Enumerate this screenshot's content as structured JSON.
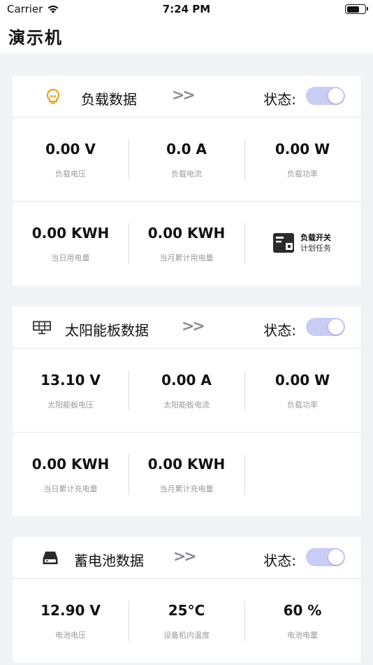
{
  "status_bar": {
    "carrier": "Carrier",
    "time": "7:24 PM"
  },
  "header": {
    "title": "演示机"
  },
  "status_label": "状态:",
  "chevron": ">>",
  "load": {
    "title": "负载数据",
    "toggle_on": true,
    "rows": [
      [
        {
          "value": "0.00 V",
          "label": "负载电压"
        },
        {
          "value": "0.0 A",
          "label": "负载电流"
        },
        {
          "value": "0.00 W",
          "label": "负载功率"
        }
      ],
      [
        {
          "value": "0.00 KWH",
          "label": "当日用电量"
        },
        {
          "value": "0.00 KWH",
          "label": "当月累计用电量"
        }
      ]
    ],
    "plan": {
      "line1": "负载开关",
      "line2": "计划任务"
    }
  },
  "solar": {
    "title": "太阳能板数据",
    "toggle_on": true,
    "rows": [
      [
        {
          "value": "13.10 V",
          "label": "太阳能板电压"
        },
        {
          "value": "0.00 A",
          "label": "太阳能板电流"
        },
        {
          "value": "0.00 W",
          "label": "负载功率"
        }
      ],
      [
        {
          "value": "0.00 KWH",
          "label": "当日累计充电量"
        },
        {
          "value": "0.00 KWH",
          "label": "当月累计充电量"
        }
      ]
    ]
  },
  "battery": {
    "title": "蓄电池数据",
    "toggle_on": true,
    "rows": [
      [
        {
          "value": "12.90 V",
          "label": "电池电压"
        },
        {
          "value": "25°C",
          "label": "设备机内温度"
        },
        {
          "value": "60 %",
          "label": "电池电量"
        }
      ]
    ]
  },
  "colors": {
    "accent_toggle": "#c9ccf5",
    "bulb_icon": "#f0a11c",
    "background": "#f1f3f7"
  }
}
